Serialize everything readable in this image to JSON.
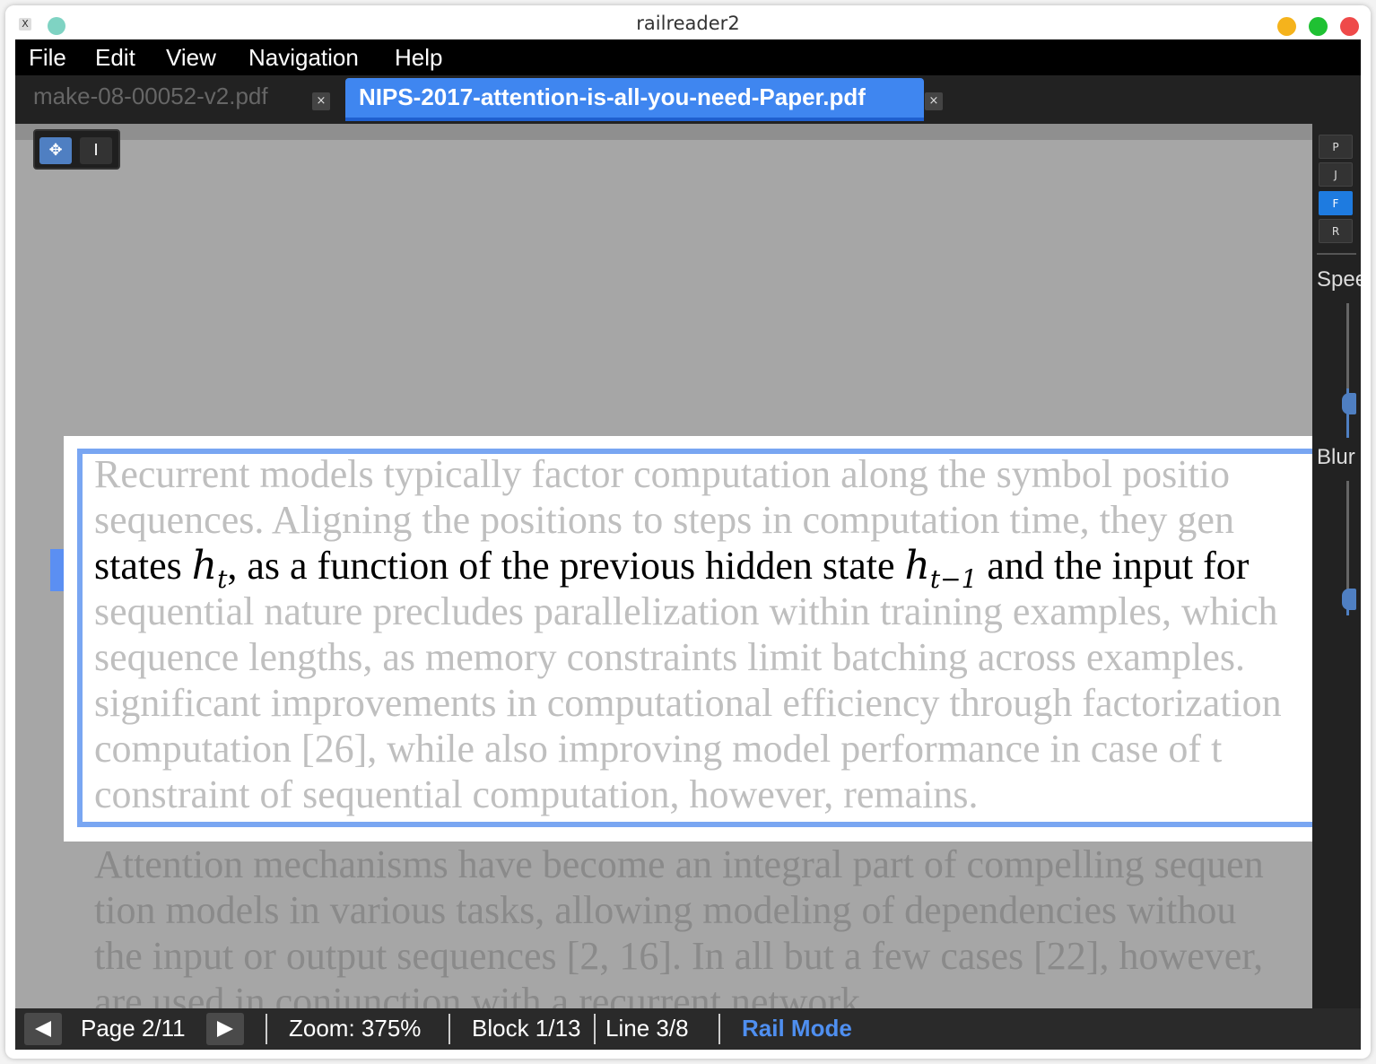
{
  "window": {
    "title": "railreader2"
  },
  "menu": [
    "File",
    "Edit",
    "View",
    "Navigation",
    "Help"
  ],
  "tabs": [
    {
      "label": "make-08-00052-v2.pdf",
      "active": false
    },
    {
      "label": "NIPS-2017-attention-is-all-you-need-Paper.pdf",
      "active": true
    }
  ],
  "tools": {
    "move_icon": "move-icon",
    "text_select_icon": "text-cursor-icon"
  },
  "document": {
    "block_lines": [
      "Recurrent models typically factor computation along the symbol positio",
      "sequences. Aligning the positions to steps in computation time, they gen",
      "",
      "sequential nature precludes parallelization within training examples, which",
      "sequence lengths, as memory constraints limit batching across examples.",
      "significant improvements in computational efficiency through factorization",
      "computation [26], while also improving model performance in case of t",
      "constraint of sequential computation, however, remains."
    ],
    "current_line": {
      "t1": "states ",
      "m1": "h",
      "s1": "t",
      "t2": ", as a function of the previous hidden state ",
      "m2": "h",
      "s2": "t−1",
      "t3": " and the input for"
    },
    "next_lines": [
      "Attention mechanisms have become an integral part of compelling sequen",
      "tion models in various tasks, allowing modeling of dependencies withou",
      "the input or output sequences [2, 16]. In all but a few cases [22], however,",
      "are used in conjunction with a recurrent network."
    ]
  },
  "side_panel": {
    "buttons": [
      "P",
      "J",
      "F",
      "R"
    ],
    "active_button": "F",
    "speed_label": "Speed",
    "blur_label": "Blur",
    "speed_value": 0.55,
    "blur_value": 0.85
  },
  "status": {
    "prev_icon": "triangle-left-icon",
    "next_icon": "triangle-right-icon",
    "page": "Page 2/11",
    "zoom": "Zoom: 375%",
    "block": "Block 1/13",
    "line": "Line 3/8",
    "mode": "Rail Mode"
  },
  "colors": {
    "accent": "#3f86f0",
    "rail_border": "#79a6f2",
    "active_mode": "#1e7be0"
  }
}
